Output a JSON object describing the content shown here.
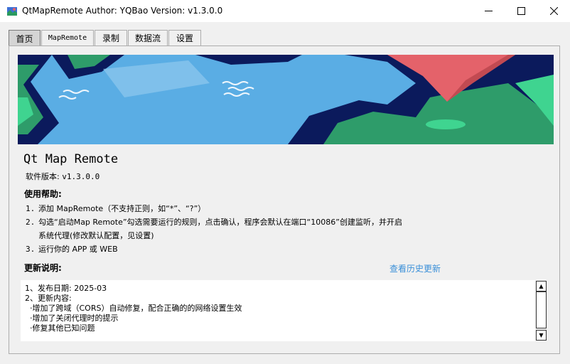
{
  "window": {
    "title": "QtMapRemote Author: YQBao Version: v1.3.0.0",
    "controls": {
      "minimize": "minimize-icon",
      "maximize": "maximize-icon",
      "close": "close-icon"
    }
  },
  "tabs": [
    {
      "label": "首页",
      "active": true
    },
    {
      "label": "MapRemote",
      "active": false
    },
    {
      "label": "录制",
      "active": false
    },
    {
      "label": "数据流",
      "active": false
    },
    {
      "label": "设置",
      "active": false
    }
  ],
  "home": {
    "app_name": "Qt Map Remote",
    "version_label": "软件版本:",
    "version_value": "v1.3.0.0",
    "help_title": "使用帮助:",
    "help_items": [
      {
        "num": "1.",
        "text": "添加 MapRemote（不支持正则，如“*”、“?”）"
      },
      {
        "num": "2.",
        "text": "勾选“启动Map Remote”勾选需要运行的规则，点击确认，程序会默认在端口“10086”创建监听，并开启"
      },
      {
        "num": "",
        "text": "系统代理(修改默认配置，见设置)"
      },
      {
        "num": "3.",
        "text": "运行你的 APP 或 WEB"
      }
    ],
    "update_title": "更新说明:",
    "history_link": "查看历史更新",
    "notes": "1、发布日期: 2025-03\n2、更新内容:\n  ·增加了跨域（CORS）自动修复，配合正确的的网络设置生效\n  ·增加了关闭代理时的提示\n  ·修复其他已知问题"
  },
  "colors": {
    "banner_sea": "#5aade4",
    "banner_dark": "#0b1a5c",
    "banner_green": "#2e9c6a",
    "banner_red": "#e4626a",
    "link": "#3a8fd8",
    "active_tab": "#d4d4d4"
  }
}
